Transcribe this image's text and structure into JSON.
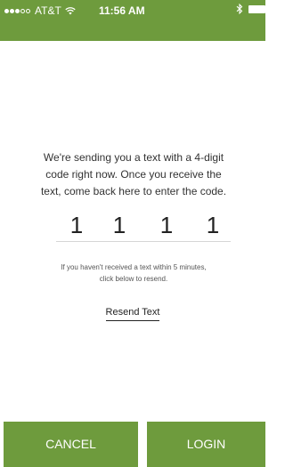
{
  "colors": {
    "accent": "#6e9b3d"
  },
  "status_bar": {
    "carrier": "AT&T",
    "time": "11:56 AM",
    "signal_icon": "signal-dots-icon",
    "wifi_icon": "wifi-icon",
    "bluetooth_icon": "bluetooth-icon",
    "battery_icon": "battery-icon"
  },
  "message": "We're sending you a text with a 4-digit code right now. Once you receive the text, come back here to enter the code.",
  "code_digits": [
    "1",
    "1",
    "1",
    "1"
  ],
  "note": "If you haven't received a text within 5 minutes, click below to resend.",
  "resend_label": "Resend Text",
  "buttons": {
    "cancel": "CANCEL",
    "login": "LOGIN"
  }
}
